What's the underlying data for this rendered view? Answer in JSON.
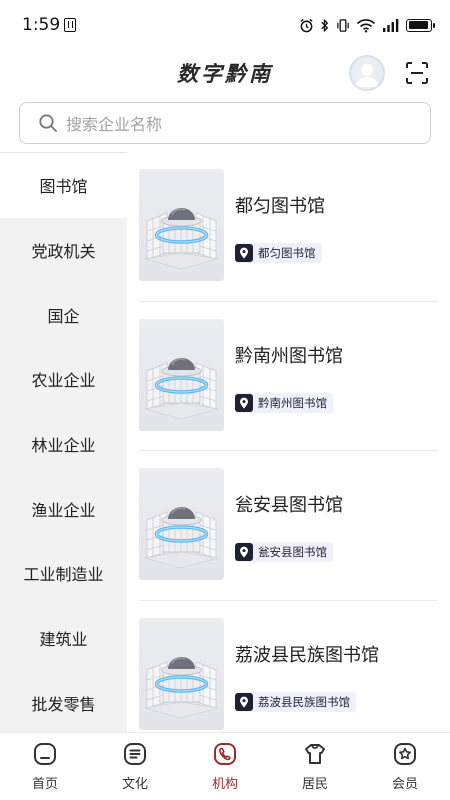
{
  "status_bar": {
    "time": "1:59"
  },
  "header": {
    "title": "数字黔南"
  },
  "search": {
    "placeholder": "搜索企业名称"
  },
  "categories": [
    {
      "label": "图书馆",
      "active": true
    },
    {
      "label": "党政机关",
      "active": false
    },
    {
      "label": "国企",
      "active": false
    },
    {
      "label": "农业企业",
      "active": false
    },
    {
      "label": "林业企业",
      "active": false
    },
    {
      "label": "渔业企业",
      "active": false
    },
    {
      "label": "工业制造业",
      "active": false
    },
    {
      "label": "建筑业",
      "active": false
    },
    {
      "label": "批发零售",
      "active": false
    }
  ],
  "libraries": [
    {
      "name": "都匀图书馆",
      "tag": "都匀图书馆"
    },
    {
      "name": "黔南州图书馆",
      "tag": "黔南州图书馆"
    },
    {
      "name": "瓮安县图书馆",
      "tag": "瓮安县图书馆"
    },
    {
      "name": "荔波县民族图书馆",
      "tag": "荔波县民族图书馆"
    }
  ],
  "tabs": [
    {
      "label": "首页",
      "icon": "home-icon",
      "active": false
    },
    {
      "label": "文化",
      "icon": "culture-icon",
      "active": false
    },
    {
      "label": "机构",
      "icon": "institution-icon",
      "active": true
    },
    {
      "label": "居民",
      "icon": "resident-icon",
      "active": false
    },
    {
      "label": "会员",
      "icon": "member-icon",
      "active": false
    }
  ],
  "colors": {
    "accent": "#9c2b2f",
    "tag_bg": "#eef1fa",
    "nav_bg": "#f2f2f2"
  }
}
